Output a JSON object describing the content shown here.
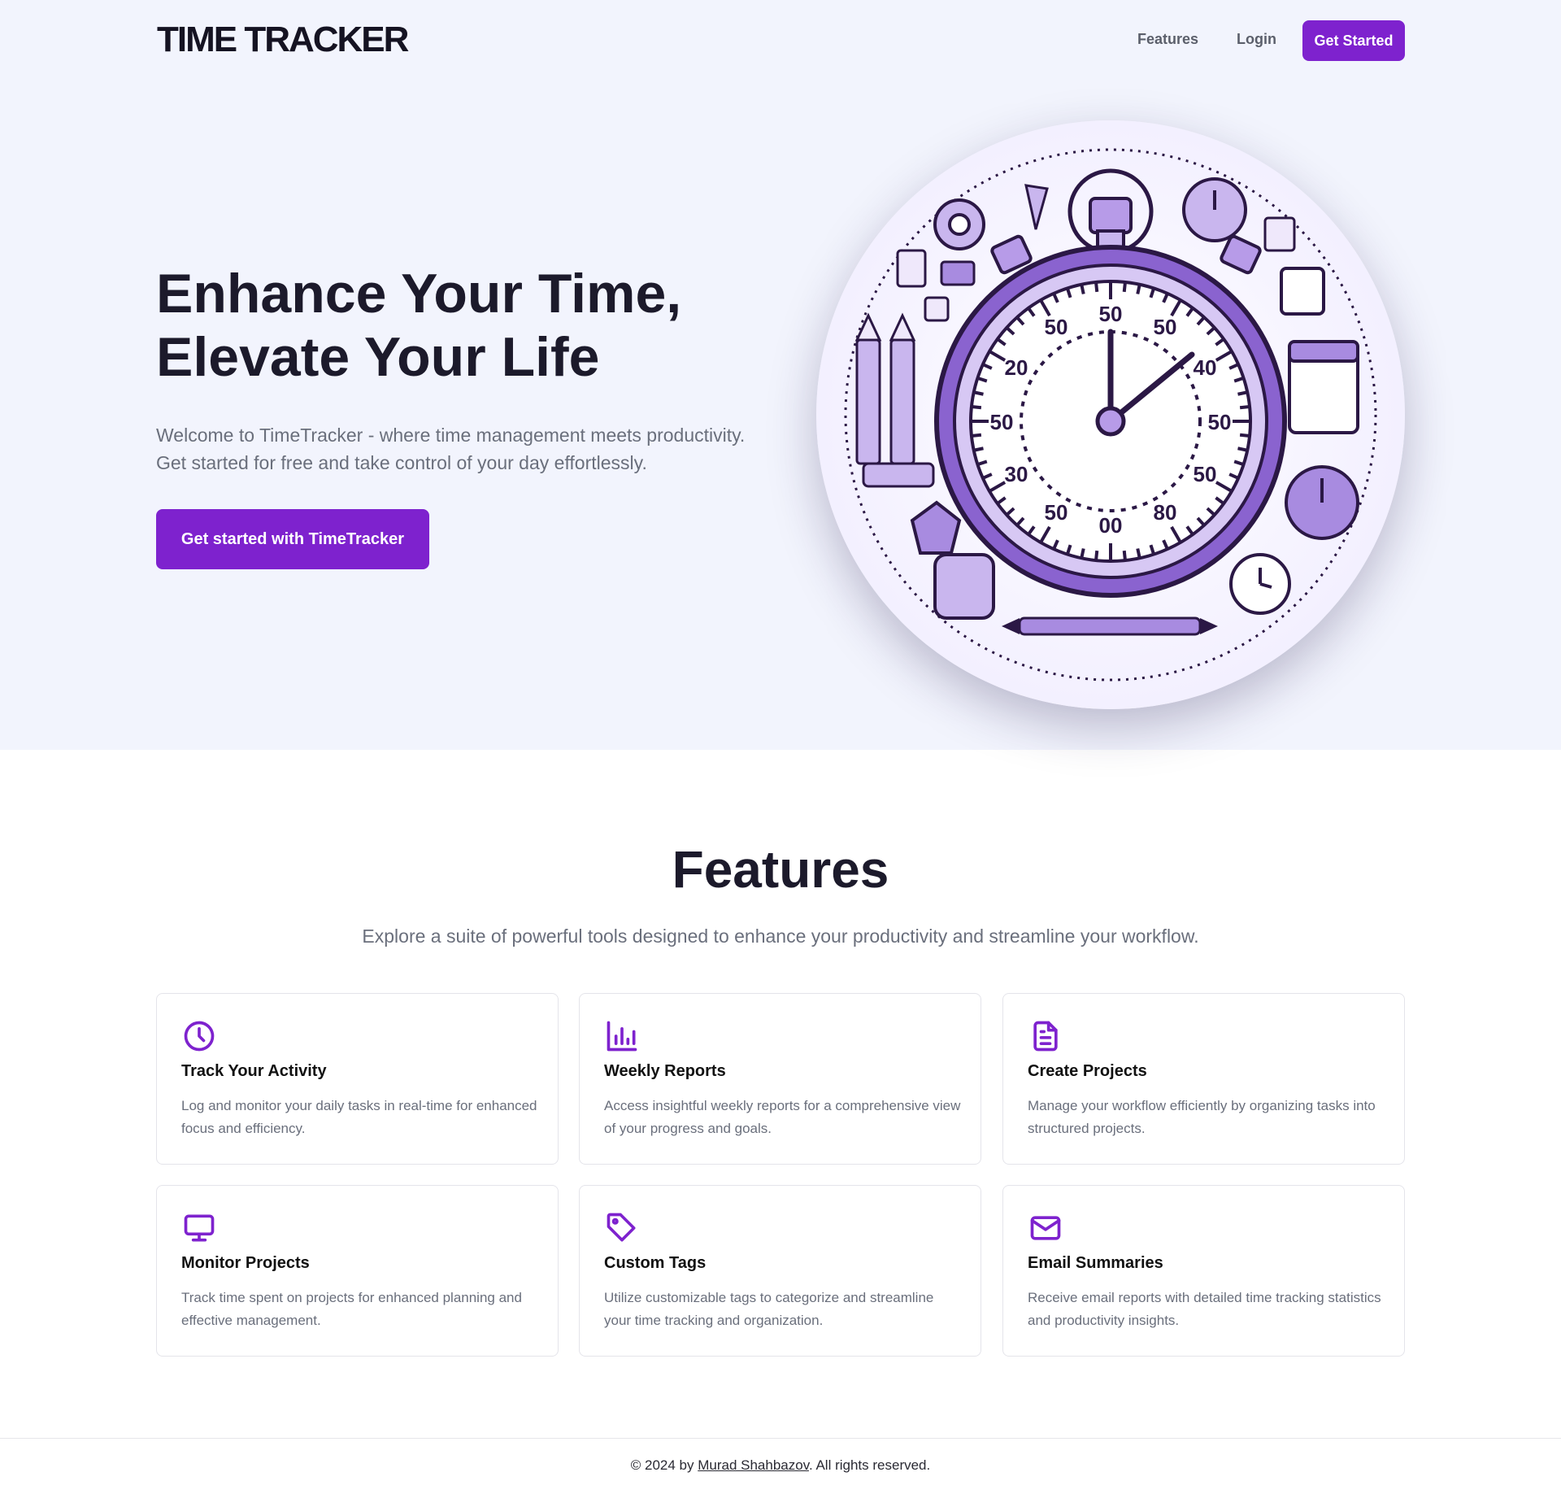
{
  "header": {
    "logo": "TIME TRACKER",
    "nav": {
      "features": "Features",
      "login": "Login",
      "cta": "Get Started"
    }
  },
  "hero": {
    "title_line1": "Enhance Your Time,",
    "title_line2": "Elevate Your Life",
    "subtitle_line1": "Welcome to TimeTracker - where time management meets productivity.",
    "subtitle_line2": "Get started for free and take control of your day effortlessly.",
    "cta": "Get started with TimeTracker",
    "dial_numbers": [
      "50",
      "50",
      "50",
      "20",
      "40",
      "50",
      "50",
      "30",
      "50",
      "50",
      "00",
      "80"
    ]
  },
  "features": {
    "title": "Features",
    "subtitle": "Explore a suite of powerful tools designed to enhance your productivity and streamline your workflow.",
    "cards": [
      {
        "icon": "clock-icon",
        "title": "Track Your Activity",
        "desc": "Log and monitor your daily tasks in real-time for enhanced focus and efficiency."
      },
      {
        "icon": "bar-chart-icon",
        "title": "Weekly Reports",
        "desc": "Access insightful weekly reports for a comprehensive view of your progress and goals."
      },
      {
        "icon": "document-icon",
        "title": "Create Projects",
        "desc": "Manage your workflow efficiently by organizing tasks into structured projects."
      },
      {
        "icon": "monitor-icon",
        "title": "Monitor Projects",
        "desc": "Track time spent on projects for enhanced planning and effective management."
      },
      {
        "icon": "tag-icon",
        "title": "Custom Tags",
        "desc": "Utilize customizable tags to categorize and streamline your time tracking and organization."
      },
      {
        "icon": "mail-icon",
        "title": "Email Summaries",
        "desc": "Receive email reports with detailed time tracking statistics and productivity insights."
      }
    ]
  },
  "footer": {
    "prefix": "© 2024 by ",
    "author": "Murad Shahbazov",
    "suffix": ". All rights reserved."
  },
  "colors": {
    "accent": "#7e22ce",
    "hero_bg": "#f2f4fd",
    "text_dark": "#1c1a2b",
    "text_muted": "#6a6f7c"
  }
}
